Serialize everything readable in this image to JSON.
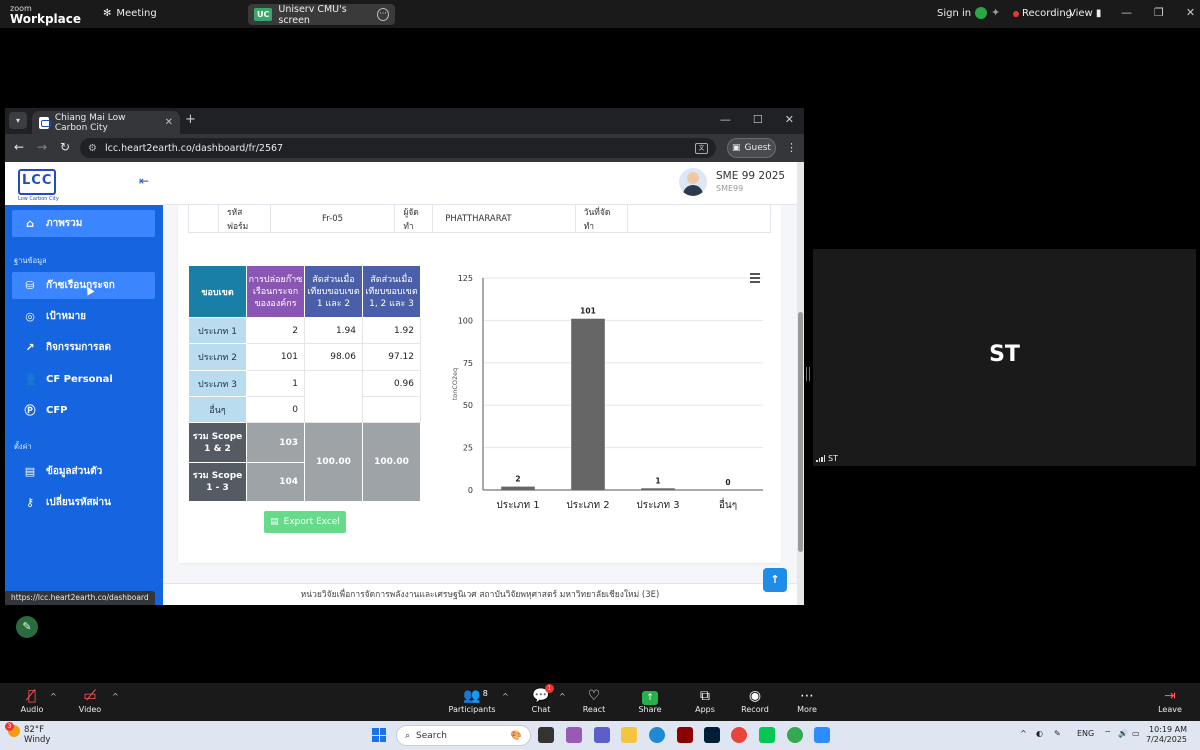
{
  "zoom_top": {
    "logo_line1": "zoom",
    "logo_line2": "Workplace",
    "meeting_label": "Meeting",
    "share_badge": "UC",
    "share_title": "Uniserv CMU's screen",
    "sign_in": "Sign in",
    "recording": "Recording",
    "view": "View"
  },
  "browser": {
    "tab_title": "Chiang Mai Low Carbon City",
    "url": "lcc.heart2earth.co/dashboard/fr/2567",
    "guest": "Guest",
    "status_url": "https://lcc.heart2earth.co/dashboard"
  },
  "sidebar": {
    "logo_subtitle": "Low Carbon City",
    "items": [
      {
        "label": "ภาพรวม",
        "icon": "home-icon"
      },
      {
        "label": "ก๊าซเรือนกระจก",
        "icon": "database-icon"
      },
      {
        "label": "เป้าหมาย",
        "icon": "target-icon"
      },
      {
        "label": "กิจกรรมการลด",
        "icon": "chart-line-icon"
      },
      {
        "label": "CF Personal",
        "icon": "user-icon"
      },
      {
        "label": "CFP",
        "icon": "p-circle-icon"
      },
      {
        "label": "ข้อมูลส่วนตัว",
        "icon": "id-card-icon"
      },
      {
        "label": "เปลี่ยนรหัสผ่าน",
        "icon": "key-icon"
      }
    ],
    "section_data": "ฐานข้อมูล",
    "section_settings": "ตั้งค่า"
  },
  "user": {
    "name": "SME 99 2025",
    "sub": "SME99"
  },
  "info_row": {
    "form_code_label": "รหัสฟอร์ม",
    "form_code_value": "Fr-05",
    "author_label": "ผู้จัดทำ",
    "author_value": "PHATTHARARAT",
    "date_label": "วันที่จัดทำ",
    "date_value": ""
  },
  "table": {
    "headers": {
      "scope": "ขอบเขต",
      "emission": "การปล่อยก๊าซเรือนกระจกขององค์กร",
      "ratio12": "สัดส่วนเมื่อเทียบขอบเขต 1 และ 2",
      "ratio123": "สัดส่วนเมื่อเทียบขอบเขต 1, 2 และ 3"
    },
    "rows": [
      {
        "label": "ประเภท 1",
        "emission": "2",
        "ratio12": "1.94",
        "ratio123": "1.92"
      },
      {
        "label": "ประเภท 2",
        "emission": "101",
        "ratio12": "98.06",
        "ratio123": "97.12"
      },
      {
        "label": "ประเภท 3",
        "emission": "1",
        "ratio12": "",
        "ratio123": "0.96"
      },
      {
        "label": "อื่นๆ",
        "emission": "0",
        "ratio12": "",
        "ratio123": ""
      }
    ],
    "sum12_label": "รวม Scope 1 & 2",
    "sum12_value": "103",
    "sum13_label": "รวม Scope 1 - 3",
    "sum13_value": "104",
    "sum_ratio12": "100.00",
    "sum_ratio123": "100.00"
  },
  "export_label": "Export Excel",
  "chart_data": {
    "type": "bar",
    "categories": [
      "ประเภท 1",
      "ประเภท 2",
      "ประเภท 3",
      "อื่นๆ"
    ],
    "values": [
      2,
      101,
      1,
      0
    ],
    "title": "",
    "xlabel": "",
    "ylabel": "tonCO2eq",
    "ylim": [
      0,
      125
    ],
    "yticks": [
      0,
      25,
      50,
      75,
      100,
      125
    ],
    "bar_color": "#666666",
    "grid": true,
    "data_labels": true
  },
  "footer_text": "หน่วยวิจัยเพื่อการจัดการพลังงานและเศรษฐนิเวศ สถาบันวิจัยพหุศาสตร์ มหาวิทยาลัยเชียงใหม่ (3E)",
  "tile": {
    "initials": "ST",
    "name": "ST"
  },
  "zoom_bottom": {
    "audio": "Audio",
    "video": "Video",
    "participants": "Participants",
    "participants_count": "8",
    "chat": "Chat",
    "chat_badge": "1",
    "react": "React",
    "share": "Share",
    "apps": "Apps",
    "record": "Record",
    "more": "More",
    "leave": "Leave"
  },
  "taskbar": {
    "temp": "82°F",
    "weather": "Windy",
    "weather_badge": "3",
    "search": "Search",
    "lang": "ENG",
    "time": "10:19 AM",
    "date": "7/24/2025"
  }
}
